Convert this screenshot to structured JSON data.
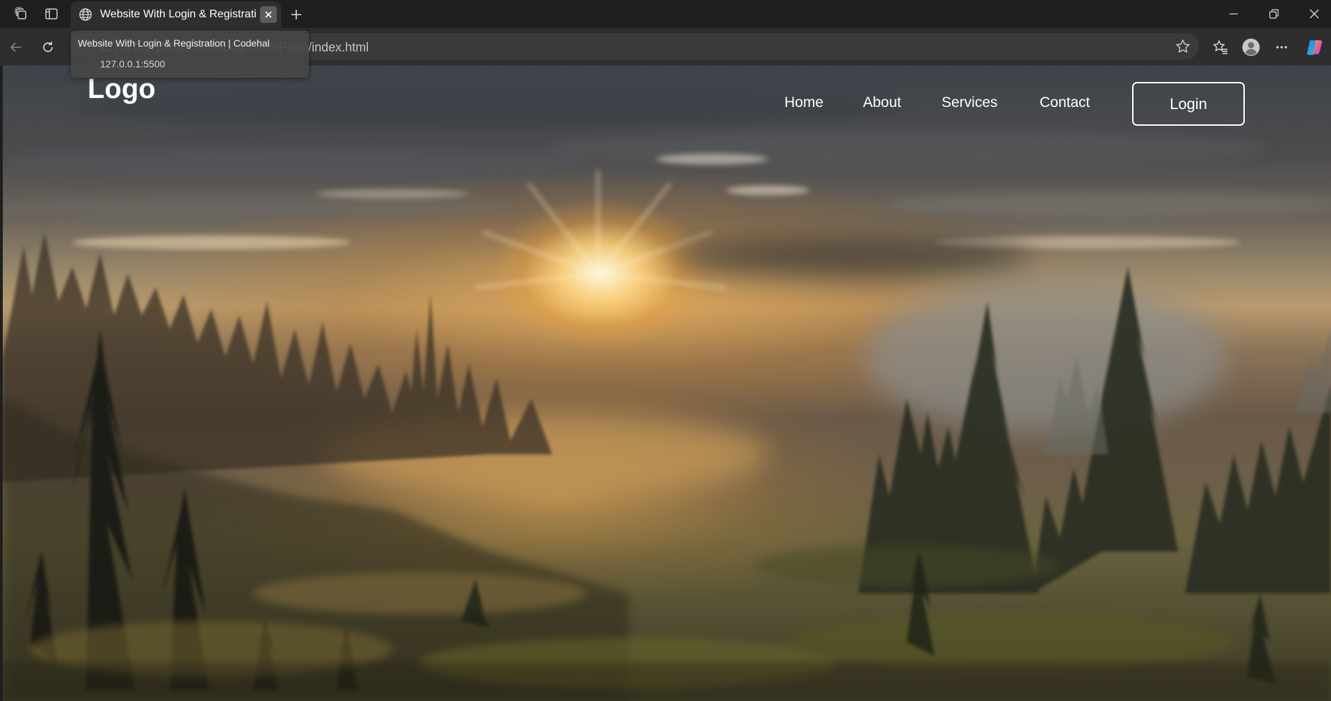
{
  "browser": {
    "tab_title": "Website With Login & Registration | Codehal",
    "url_display": "127.0.0.1:5500/shena/Login%20Page/index.html",
    "hovercard": {
      "title": "Website With Login & Registration | Codehal",
      "url": "127.0.0.1:5500"
    },
    "icons": [
      "workspaces-icon",
      "vertical-tabs-icon",
      "globe-icon",
      "close-icon",
      "plus-icon",
      "minimize-icon",
      "restore-icon",
      "window-close-icon",
      "back-icon",
      "refresh-icon",
      "info-icon",
      "star-icon",
      "favorites-icon",
      "profile-icon",
      "more-icon",
      "copilot-icon"
    ]
  },
  "site": {
    "logo": "Logo",
    "nav": [
      "Home",
      "About",
      "Services",
      "Contact"
    ],
    "login_label": "Login"
  }
}
